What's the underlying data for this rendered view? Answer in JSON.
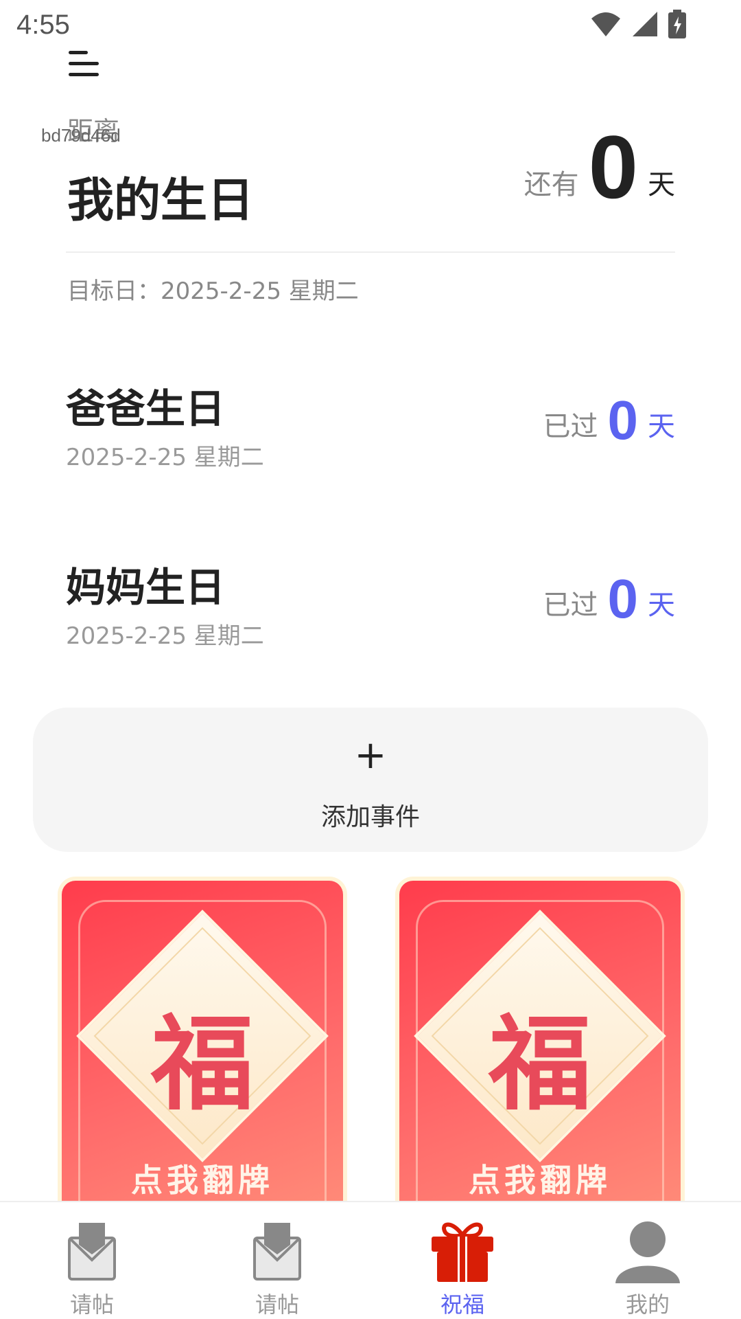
{
  "status_bar": {
    "time": "4:55"
  },
  "hero": {
    "overlay_code": "bd79d46d",
    "small_label": "距离",
    "title": "我的生日",
    "prefix": "还有",
    "days": "0",
    "unit": "天",
    "target_date": "目标日：2025-2-25 星期二"
  },
  "events": [
    {
      "name": "爸爸生日",
      "date": "2025-2-25 星期二",
      "prefix": "已过",
      "days": "0",
      "unit": "天"
    },
    {
      "name": "妈妈生日",
      "date": "2025-2-25 星期二",
      "prefix": "已过",
      "days": "0",
      "unit": "天"
    }
  ],
  "add_event": {
    "plus": "+",
    "label": "添加事件"
  },
  "fu_cards": [
    {
      "char": "福",
      "label": "点我翻牌"
    },
    {
      "char": "福",
      "label": "点我翻牌"
    }
  ],
  "tab_bar": {
    "tabs": [
      {
        "label": "请帖",
        "icon": "invitation-icon"
      },
      {
        "label": "请帖",
        "icon": "invitation-icon"
      },
      {
        "label": "祝福",
        "icon": "gift-icon"
      },
      {
        "label": "我的",
        "icon": "user-icon"
      }
    ],
    "active_index": 2
  },
  "colors": {
    "accent": "#5b63f0",
    "gift_red": "#d81e06",
    "tab_gray": "#888888"
  }
}
